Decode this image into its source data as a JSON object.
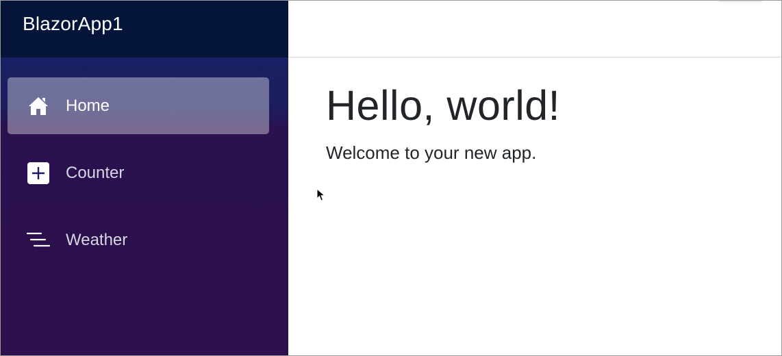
{
  "app": {
    "brand": "BlazorApp1"
  },
  "sidebar": {
    "items": [
      {
        "label": "Home",
        "icon": "home-icon",
        "active": true
      },
      {
        "label": "Counter",
        "icon": "plus-square-icon",
        "active": false
      },
      {
        "label": "Weather",
        "icon": "list-lines-icon",
        "active": false
      }
    ]
  },
  "main": {
    "title": "Hello, world!",
    "text": "Welcome to your new app."
  },
  "colors": {
    "sidebar_top": "#05153a",
    "sidebar_gradient_start": "#14246a",
    "sidebar_gradient_end": "#2c0f4c",
    "active_item": "rgba(255,255,255,0.37)",
    "text": "#212529"
  }
}
